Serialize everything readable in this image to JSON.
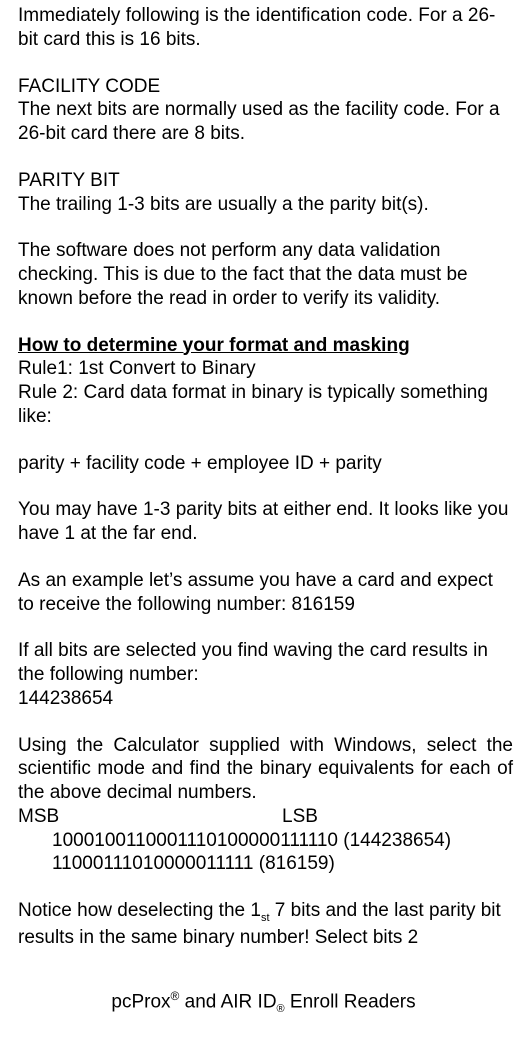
{
  "body": {
    "p1": "Immediately following is the identification code. For a 26-bit card this is 16 bits.",
    "h1": "FACILITY CODE",
    "p2": "The next bits are normally used as the facility code. For a 26-bit card there are 8 bits.",
    "h2": "PARITY BIT",
    "p3": "The trailing 1-3 bits are usually a the parity bit(s).",
    "p4": "The software does not perform any data validation checking. This is due to the fact that the data must be known before the read in order to verify its validity.",
    "h3": "How to determine your format and masking",
    "p5": "Rule1: 1st Convert to Binary",
    "p6": "Rule 2: Card data format in binary is typically something like:",
    "p7": "parity + facility code + employee ID + parity",
    "p8": "You may have 1-3 parity bits at either end. It looks like you have 1 at the far end.",
    "p9": "As an example let’s assume you have a card and expect to receive the following number: 816159",
    "p10": "If all bits are selected you find waving the card results in the following number:",
    "p11": "144238654",
    "p12": "Using the Calculator supplied with Windows, select the scientific mode and find the binary equivalents for each of the above decimal numbers.",
    "msb": "MSB",
    "lsb": "LSB",
    "bin1": "1000100110001110100000111110 (144238654)",
    "bin2": "11000111010000011111 (816159)",
    "p13a": "Notice how deselecting the 1",
    "p13sub": "st",
    "p13b": " 7 bits and the last parity bit results in the same binary number! Select bits 2"
  },
  "footer": {
    "a": "pcProx",
    "sup": "®",
    "b": " and AIR ID",
    "sub": "®",
    "c": " Enroll Readers"
  }
}
